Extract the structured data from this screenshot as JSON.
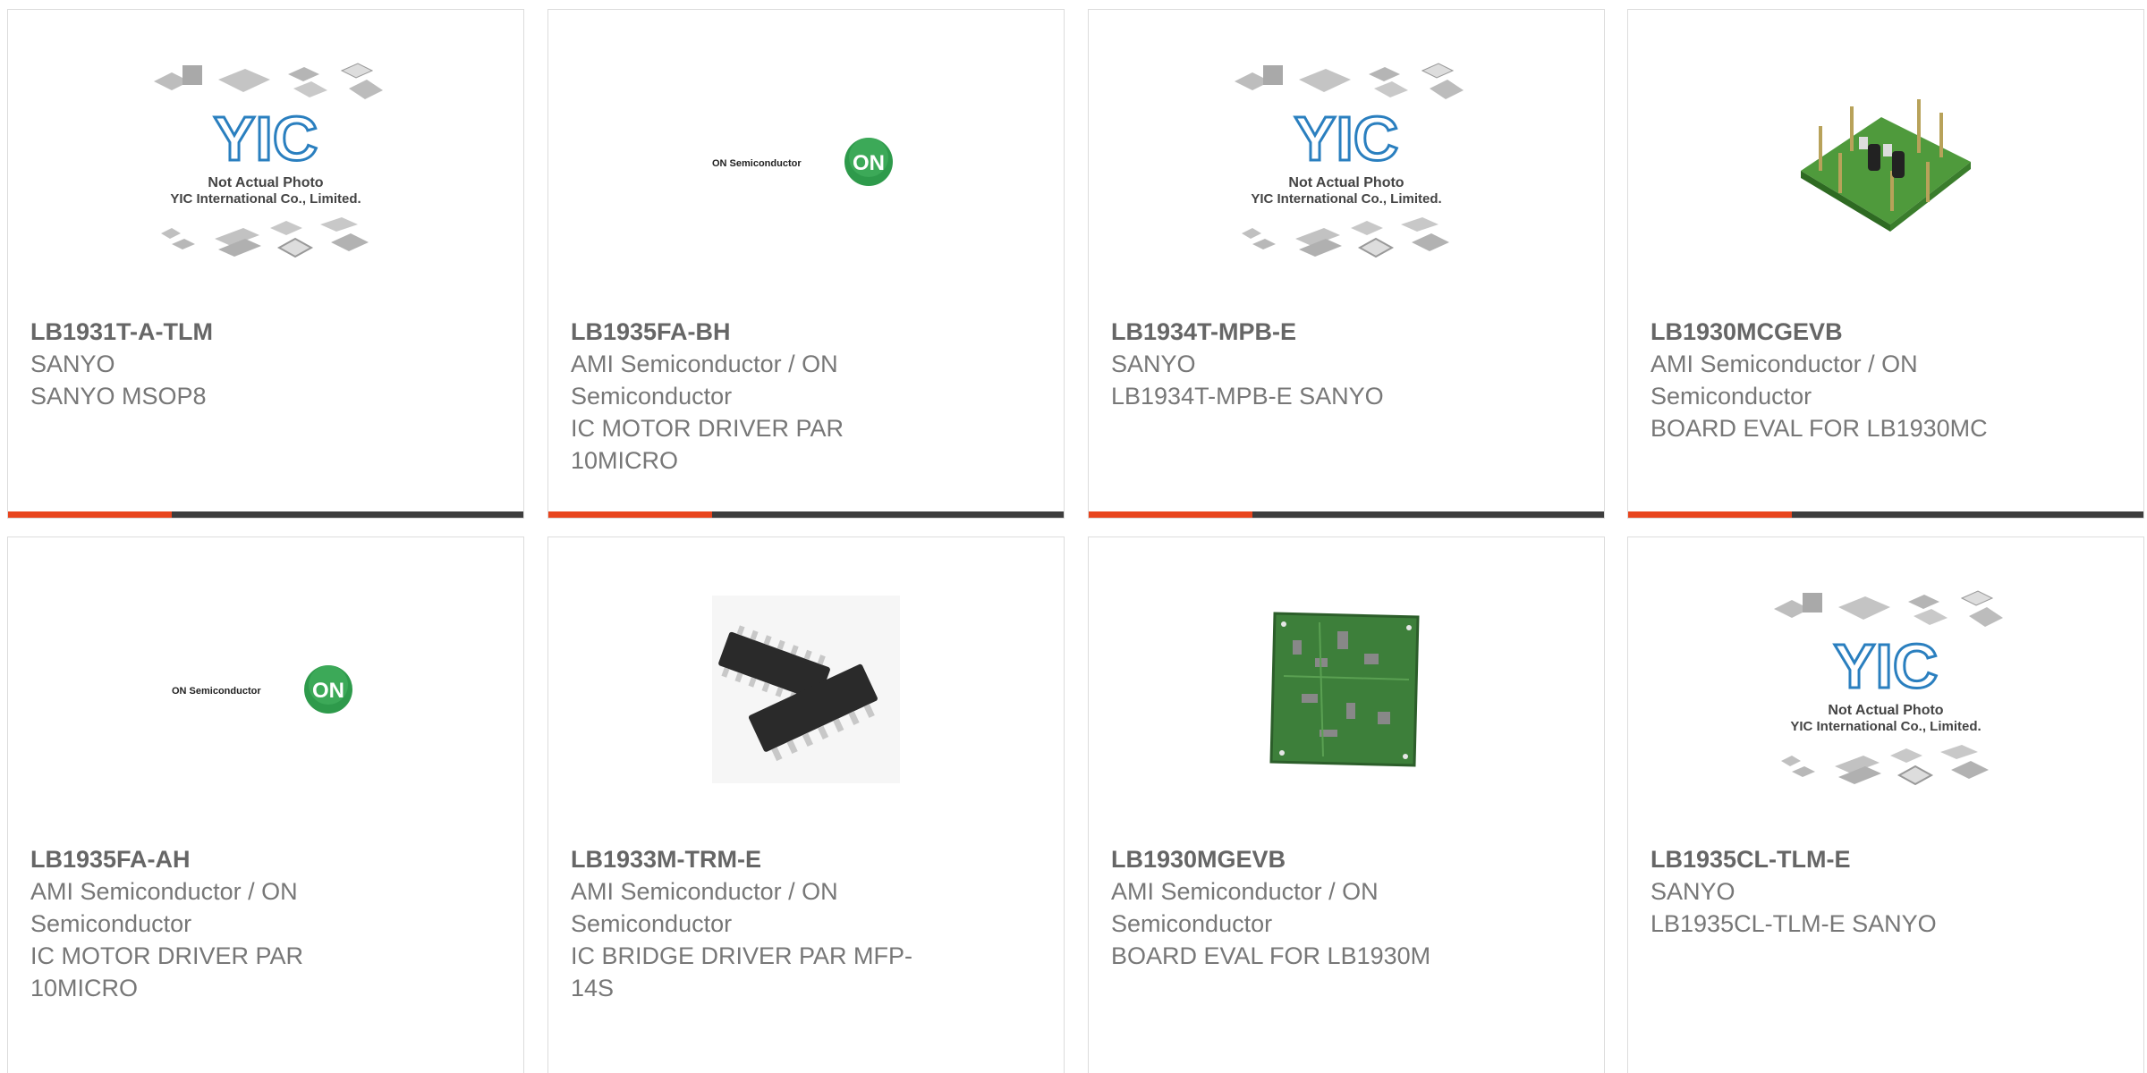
{
  "colors": {
    "accent": "#e8451e",
    "bar": "#3d3d3d",
    "border": "#dcdcdc",
    "text": "#666666"
  },
  "placeholder": {
    "line1": "Not Actual Photo",
    "line2": "YIC International Co., Limited.",
    "logo_text": "YIC"
  },
  "on_logo": {
    "wordmark": "ON Semiconductor",
    "mark": "ON"
  },
  "products": [
    {
      "part": "LB1931T-A-TLM",
      "maker": "SANYO",
      "desc": "SANYO MSOP8",
      "image": "yic-placeholder-icon"
    },
    {
      "part": "LB1935FA-BH",
      "maker": "AMI Semiconductor / ON Semiconductor",
      "desc": "IC MOTOR DRIVER PAR 10MICRO",
      "image": "on-semiconductor-logo"
    },
    {
      "part": "LB1934T-MPB-E",
      "maker": "SANYO",
      "desc": "LB1934T-MPB-E SANYO",
      "image": "yic-placeholder-icon"
    },
    {
      "part": "LB1930MCGEVB",
      "maker": "AMI Semiconductor / ON Semiconductor",
      "desc": "BOARD EVAL FOR LB1930MC",
      "image": "eval-board-photo"
    },
    {
      "part": "LB1935FA-AH",
      "maker": "AMI Semiconductor / ON Semiconductor",
      "desc": "IC MOTOR DRIVER PAR 10MICRO",
      "image": "on-semiconductor-logo"
    },
    {
      "part": "LB1933M-TRM-E",
      "maker": "AMI Semiconductor / ON Semiconductor",
      "desc": "IC BRIDGE DRIVER PAR MFP-14S",
      "image": "ic-chip-photo"
    },
    {
      "part": "LB1930MGEVB",
      "maker": "AMI Semiconductor / ON Semiconductor",
      "desc": "BOARD EVAL FOR LB1930M",
      "image": "pcb-board-photo"
    },
    {
      "part": "LB1935CL-TLM-E",
      "maker": "SANYO",
      "desc": "LB1935CL-TLM-E SANYO",
      "image": "yic-placeholder-icon"
    }
  ]
}
